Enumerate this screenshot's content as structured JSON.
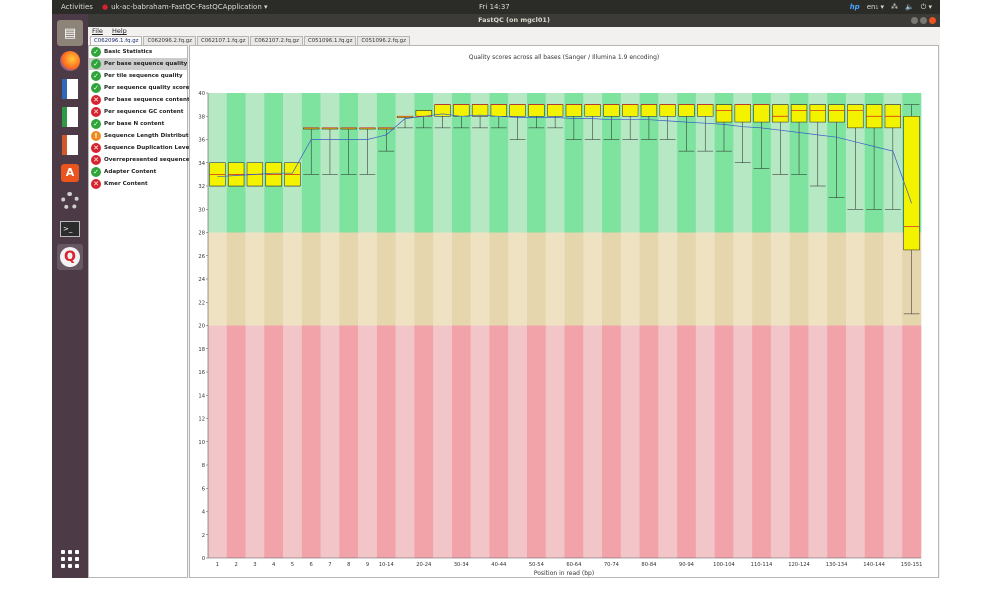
{
  "topbar": {
    "activities": "Activities",
    "app": "uk-ac-babraham-FastQC-FastQCApplication ▾",
    "clock": "Fri 14:37",
    "lang": "en₁ ▾"
  },
  "window": {
    "title": "FastQC (on mgcl01)"
  },
  "menu": {
    "file": "File",
    "help": "Help"
  },
  "tabs": [
    "C062096.1.fq.gz",
    "C062096.2.fq.gz",
    "C062107.1.fq.gz",
    "C062107.2.fq.gz",
    "C051096.1.fq.gz",
    "C051096.2.fq.gz"
  ],
  "modules": [
    {
      "label": "Basic Statistics",
      "status": "pass"
    },
    {
      "label": "Per base sequence quality",
      "status": "pass"
    },
    {
      "label": "Per tile sequence quality",
      "status": "pass"
    },
    {
      "label": "Per sequence quality scores",
      "status": "pass"
    },
    {
      "label": "Per base sequence content",
      "status": "fail"
    },
    {
      "label": "Per sequence GC content",
      "status": "fail"
    },
    {
      "label": "Per base N content",
      "status": "pass"
    },
    {
      "label": "Sequence Length Distribution",
      "status": "warn"
    },
    {
      "label": "Sequence Duplication Levels",
      "status": "fail"
    },
    {
      "label": "Overrepresented sequences",
      "status": "fail"
    },
    {
      "label": "Adapter Content",
      "status": "pass"
    },
    {
      "label": "Kmer Content",
      "status": "fail"
    }
  ],
  "status_colors": {
    "pass": "#2fa43a",
    "fail": "#d6232e",
    "warn": "#ef8a1e"
  },
  "launcher_icons": [
    "files-icon",
    "firefox-icon",
    "writer-icon",
    "calc-icon",
    "impress-icon",
    "software-center-icon",
    "settings-icon",
    "terminal-icon",
    "fastqc-icon",
    "show-apps-icon"
  ],
  "chart_data": {
    "type": "box",
    "title": "Quality scores across all bases (Sanger / Illumina 1.9 encoding)",
    "xlabel": "Position in read (bp)",
    "ylabel": "",
    "ylim": [
      0,
      40
    ],
    "yticks": [
      0,
      2,
      4,
      6,
      8,
      10,
      12,
      14,
      16,
      18,
      20,
      22,
      24,
      26,
      28,
      30,
      32,
      34,
      36,
      38,
      40
    ],
    "bands": [
      {
        "from": 28,
        "to": 40,
        "color": "good"
      },
      {
        "from": 20,
        "to": 28,
        "color": "ok"
      },
      {
        "from": 0,
        "to": 20,
        "color": "poor"
      }
    ],
    "categories": [
      "1",
      "2",
      "3",
      "4",
      "5",
      "6",
      "7",
      "8",
      "9",
      "10-14",
      "15-19",
      "20-24",
      "25-29",
      "30-34",
      "35-39",
      "40-44",
      "45-49",
      "50-54",
      "55-59",
      "60-64",
      "65-69",
      "70-74",
      "75-79",
      "80-84",
      "85-89",
      "90-94",
      "95-99",
      "100-104",
      "105-109",
      "110-114",
      "115-119",
      "120-124",
      "125-129",
      "130-134",
      "135-139",
      "140-144",
      "145-149",
      "150-151"
    ],
    "xtick_labels": [
      "1",
      "2",
      "3",
      "4",
      "5",
      "6",
      "7",
      "8",
      "9",
      "10-14",
      "",
      "20-24",
      "",
      "30-34",
      "",
      "40-44",
      "",
      "50-54",
      "",
      "60-64",
      "",
      "70-74",
      "",
      "80-84",
      "",
      "90-94",
      "",
      "100-104",
      "",
      "110-114",
      "",
      "120-124",
      "",
      "130-134",
      "",
      "140-144",
      "",
      "150-151"
    ],
    "boxes": [
      {
        "low": 32,
        "q1": 32,
        "median": 33,
        "q3": 34,
        "high": 34,
        "mean": 32.8
      },
      {
        "low": 32,
        "q1": 32,
        "median": 33,
        "q3": 34,
        "high": 34,
        "mean": 32.9
      },
      {
        "low": 32,
        "q1": 32,
        "median": 33,
        "q3": 34,
        "high": 34,
        "mean": 33.0
      },
      {
        "low": 32,
        "q1": 32,
        "median": 33,
        "q3": 34,
        "high": 34,
        "mean": 33.1
      },
      {
        "low": 32,
        "q1": 32,
        "median": 33,
        "q3": 34,
        "high": 34,
        "mean": 33.1
      },
      {
        "low": 33,
        "q1": 37,
        "median": 37,
        "q3": 37,
        "high": 37,
        "mean": 36.0
      },
      {
        "low": 33,
        "q1": 37,
        "median": 37,
        "q3": 37,
        "high": 37,
        "mean": 36.0
      },
      {
        "low": 33,
        "q1": 37,
        "median": 37,
        "q3": 37,
        "high": 37,
        "mean": 36.0
      },
      {
        "low": 33,
        "q1": 37,
        "median": 37,
        "q3": 37,
        "high": 37,
        "mean": 36.0
      },
      {
        "low": 35,
        "q1": 37,
        "median": 37,
        "q3": 37,
        "high": 37,
        "mean": 36.4
      },
      {
        "low": 37,
        "q1": 38,
        "median": 38,
        "q3": 38,
        "high": 38,
        "mean": 37.8
      },
      {
        "low": 37,
        "q1": 38,
        "median": 38,
        "q3": 38.5,
        "high": 38.5,
        "mean": 38.0
      },
      {
        "low": 37,
        "q1": 38,
        "median": 39,
        "q3": 39,
        "high": 39,
        "mean": 38.2
      },
      {
        "low": 37,
        "q1": 38,
        "median": 39,
        "q3": 39,
        "high": 39,
        "mean": 38.0
      },
      {
        "low": 37,
        "q1": 38,
        "median": 39,
        "q3": 39,
        "high": 39,
        "mean": 38.1
      },
      {
        "low": 37,
        "q1": 38,
        "median": 39,
        "q3": 39,
        "high": 39,
        "mean": 38.0
      },
      {
        "low": 36,
        "q1": 38,
        "median": 39,
        "q3": 39,
        "high": 39,
        "mean": 37.9
      },
      {
        "low": 37,
        "q1": 38,
        "median": 39,
        "q3": 39,
        "high": 39,
        "mean": 37.9
      },
      {
        "low": 37,
        "q1": 38,
        "median": 39,
        "q3": 39,
        "high": 39,
        "mean": 37.9
      },
      {
        "low": 36,
        "q1": 38,
        "median": 39,
        "q3": 39,
        "high": 39,
        "mean": 37.8
      },
      {
        "low": 36,
        "q1": 38,
        "median": 39,
        "q3": 39,
        "high": 39,
        "mean": 37.8
      },
      {
        "low": 36,
        "q1": 38,
        "median": 39,
        "q3": 39,
        "high": 39,
        "mean": 37.7
      },
      {
        "low": 36,
        "q1": 38,
        "median": 39,
        "q3": 39,
        "high": 39,
        "mean": 37.7
      },
      {
        "low": 36,
        "q1": 38,
        "median": 39,
        "q3": 39,
        "high": 39,
        "mean": 37.7
      },
      {
        "low": 36,
        "q1": 38,
        "median": 39,
        "q3": 39,
        "high": 39,
        "mean": 37.6
      },
      {
        "low": 35,
        "q1": 38,
        "median": 39,
        "q3": 39,
        "high": 39,
        "mean": 37.5
      },
      {
        "low": 35,
        "q1": 38,
        "median": 39,
        "q3": 39,
        "high": 39,
        "mean": 37.4
      },
      {
        "low": 35,
        "q1": 37.5,
        "median": 38.5,
        "q3": 39,
        "high": 39,
        "mean": 37.3
      },
      {
        "low": 34,
        "q1": 37.5,
        "median": 39,
        "q3": 39,
        "high": 39,
        "mean": 37.1
      },
      {
        "low": 33.5,
        "q1": 37.5,
        "median": 39,
        "q3": 39,
        "high": 39,
        "mean": 37.0
      },
      {
        "low": 33,
        "q1": 37.5,
        "median": 38,
        "q3": 39,
        "high": 39,
        "mean": 36.8
      },
      {
        "low": 33,
        "q1": 37.5,
        "median": 38.5,
        "q3": 39,
        "high": 39,
        "mean": 36.6
      },
      {
        "low": 32,
        "q1": 37.5,
        "median": 38.5,
        "q3": 39,
        "high": 39,
        "mean": 36.4
      },
      {
        "low": 31,
        "q1": 37.5,
        "median": 38.5,
        "q3": 39,
        "high": 39,
        "mean": 36.2
      },
      {
        "low": 30,
        "q1": 37,
        "median": 38.5,
        "q3": 39,
        "high": 39,
        "mean": 35.8
      },
      {
        "low": 30,
        "q1": 37,
        "median": 38,
        "q3": 39,
        "high": 39,
        "mean": 35.4
      },
      {
        "low": 30,
        "q1": 37,
        "median": 38,
        "q3": 39,
        "high": 39,
        "mean": 35.0
      },
      {
        "low": 21,
        "q1": 26.5,
        "median": 28.5,
        "q3": 38,
        "high": 39,
        "mean": 30.5
      }
    ],
    "grid": false
  }
}
